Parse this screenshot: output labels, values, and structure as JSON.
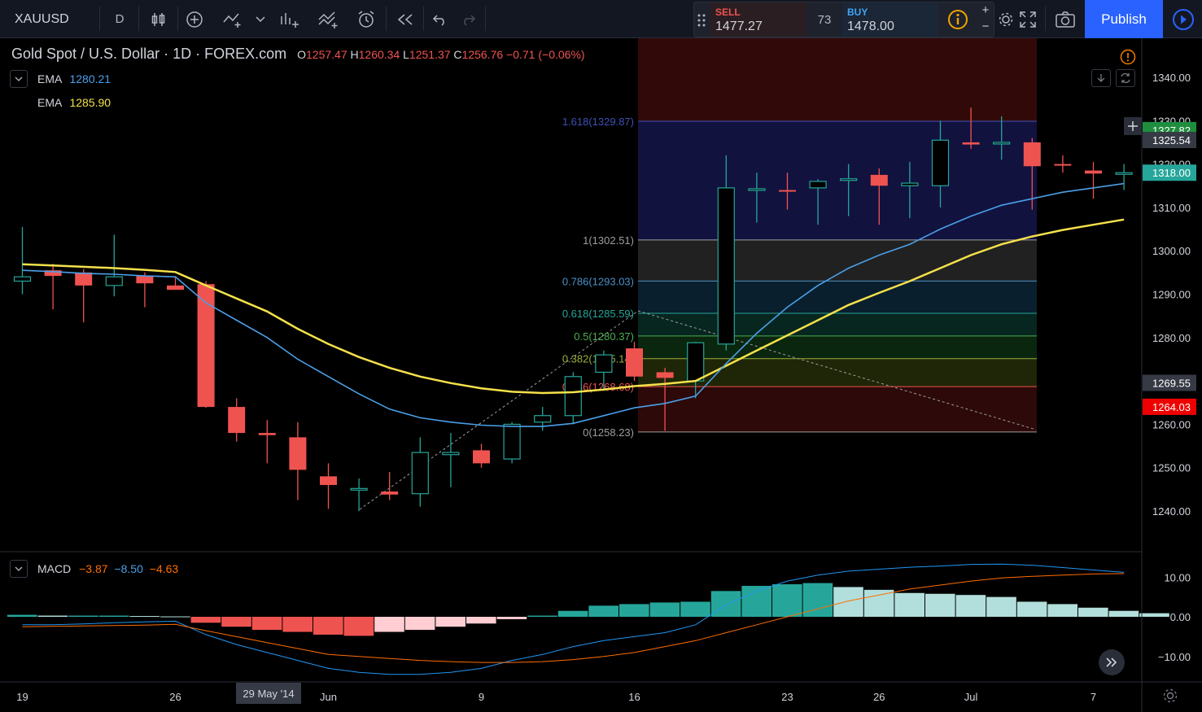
{
  "toolbar": {
    "symbol": "XAUUSD",
    "interval": "D",
    "sell_label": "SELL",
    "sell_price": "1477.27",
    "spread": "73",
    "buy_label": "BUY",
    "buy_price": "1478.00",
    "publish_label": "Publish",
    "plus": "+",
    "minus": "−"
  },
  "legend": {
    "title": "Gold Spot / U.S. Dollar · 1D · FOREX.com",
    "o_key": "O",
    "o_val": "1257.47",
    "h_key": "H",
    "h_val": "1260.34",
    "l_key": "L",
    "l_val": "1251.37",
    "c_key": "C",
    "c_val": "1256.76",
    "change": "−0.71 (−0.06%)"
  },
  "indicators": {
    "ema1_label": "EMA",
    "ema1_value": "1280.21",
    "ema2_label": "EMA",
    "ema2_value": "1285.90",
    "macd_label": "MACD",
    "macd_v1": "−3.87",
    "macd_v2": "−8.50",
    "macd_v3": "−4.63"
  },
  "date_badge": "29 May '14",
  "colors": {
    "up": "#26a69a",
    "down": "#ef5350",
    "ema_fast": "#4a9fe8",
    "ema_slow": "#f5e14b",
    "macd_line": "#2196f3",
    "signal_line": "#ff6d00",
    "accent": "#2962ff"
  },
  "chart_data": {
    "type": "candlestick",
    "ylim": [
      1231,
      1349
    ],
    "y_ticks": [
      1240,
      1250,
      1260,
      1270,
      1280,
      1290,
      1300,
      1310,
      1320,
      1330,
      1340
    ],
    "x_tick_labels": [
      "19",
      "26",
      "Jun",
      "9",
      "16",
      "23",
      "26",
      "Jul",
      "7"
    ],
    "x_tick_index": [
      0,
      5,
      10,
      15,
      20,
      25,
      28,
      31,
      35
    ],
    "candles": [
      {
        "o": 1293.0,
        "h": 1305.5,
        "l": 1290.0,
        "c": 1294.0
      },
      {
        "o": 1295.5,
        "h": 1297.0,
        "l": 1286.5,
        "c": 1294.2
      },
      {
        "o": 1295.0,
        "h": 1295.8,
        "l": 1283.5,
        "c": 1292.0
      },
      {
        "o": 1292.0,
        "h": 1303.7,
        "l": 1289.5,
        "c": 1294.0
      },
      {
        "o": 1294.3,
        "h": 1295.0,
        "l": 1287.0,
        "c": 1292.5
      },
      {
        "o": 1292.0,
        "h": 1294.0,
        "l": 1291.0,
        "c": 1291.0
      },
      {
        "o": 1292.3,
        "h": 1293.0,
        "l": 1263.8,
        "c": 1264.0
      },
      {
        "o": 1264.0,
        "h": 1266.0,
        "l": 1256.0,
        "c": 1258.0
      },
      {
        "o": 1258.0,
        "h": 1261.0,
        "l": 1251.0,
        "c": 1257.5
      },
      {
        "o": 1257.0,
        "h": 1260.5,
        "l": 1242.5,
        "c": 1249.5
      },
      {
        "o": 1248.0,
        "h": 1251.0,
        "l": 1240.5,
        "c": 1246.0
      },
      {
        "o": 1245.0,
        "h": 1247.5,
        "l": 1240.0,
        "c": 1245.2
      },
      {
        "o": 1244.5,
        "h": 1249.0,
        "l": 1242.5,
        "c": 1243.8
      },
      {
        "o": 1244.0,
        "h": 1257.0,
        "l": 1241.0,
        "c": 1253.5
      },
      {
        "o": 1253.0,
        "h": 1258.0,
        "l": 1245.5,
        "c": 1253.5
      },
      {
        "o": 1254.0,
        "h": 1255.5,
        "l": 1250.0,
        "c": 1251.0
      },
      {
        "o": 1252.0,
        "h": 1260.5,
        "l": 1251.0,
        "c": 1260.0
      },
      {
        "o": 1260.5,
        "h": 1264.0,
        "l": 1258.5,
        "c": 1262.0
      },
      {
        "o": 1262.0,
        "h": 1272.0,
        "l": 1260.0,
        "c": 1271.0
      },
      {
        "o": 1272.0,
        "h": 1277.0,
        "l": 1268.0,
        "c": 1276.0
      },
      {
        "o": 1277.5,
        "h": 1279.0,
        "l": 1270.0,
        "c": 1271.0
      },
      {
        "o": 1272.0,
        "h": 1273.0,
        "l": 1258.5,
        "c": 1270.7
      },
      {
        "o": 1270.0,
        "h": 1279.0,
        "l": 1266.0,
        "c": 1278.8
      },
      {
        "o": 1278.5,
        "h": 1322.0,
        "l": 1277.0,
        "c": 1314.5
      },
      {
        "o": 1314.0,
        "h": 1318.0,
        "l": 1306.5,
        "c": 1314.3
      },
      {
        "o": 1314.0,
        "h": 1318.0,
        "l": 1309.5,
        "c": 1313.8
      },
      {
        "o": 1314.5,
        "h": 1316.5,
        "l": 1306.0,
        "c": 1316.0
      },
      {
        "o": 1316.3,
        "h": 1320.0,
        "l": 1308.0,
        "c": 1316.6
      },
      {
        "o": 1317.5,
        "h": 1319.0,
        "l": 1306.0,
        "c": 1315.0
      },
      {
        "o": 1315.0,
        "h": 1320.5,
        "l": 1307.5,
        "c": 1315.6
      },
      {
        "o": 1315.0,
        "h": 1330.0,
        "l": 1310.0,
        "c": 1325.5
      },
      {
        "o": 1325.0,
        "h": 1333.0,
        "l": 1323.5,
        "c": 1324.5
      },
      {
        "o": 1325.0,
        "h": 1331.0,
        "l": 1321.0,
        "c": 1325.0
      },
      {
        "o": 1325.0,
        "h": 1326.0,
        "l": 1309.5,
        "c": 1319.5
      },
      {
        "o": 1320.0,
        "h": 1322.0,
        "l": 1318.0,
        "c": 1319.8
      },
      {
        "o": 1318.5,
        "h": 1320.5,
        "l": 1312.0,
        "c": 1317.8
      },
      {
        "o": 1318.0,
        "h": 1320.0,
        "l": 1314.0,
        "c": 1318.0
      }
    ],
    "ema_fast": [
      1295.5,
      1295.2,
      1294.8,
      1294.6,
      1294.2,
      1294.0,
      1288.0,
      1284.0,
      1280.0,
      1275.0,
      1271.0,
      1267.0,
      1263.5,
      1261.5,
      1260.5,
      1259.8,
      1259.5,
      1259.5,
      1260.2,
      1262.0,
      1263.8,
      1264.8,
      1266.5,
      1274.0,
      1281.0,
      1287.0,
      1292.0,
      1296.0,
      1299.0,
      1301.5,
      1305.0,
      1308.0,
      1310.5,
      1312.0,
      1313.5,
      1314.5,
      1315.5
    ],
    "ema_slow": [
      1296.9,
      1296.6,
      1296.3,
      1296.0,
      1295.6,
      1295.1,
      1292.0,
      1289.0,
      1286.0,
      1282.0,
      1278.5,
      1275.5,
      1273.0,
      1271.0,
      1269.5,
      1268.3,
      1267.5,
      1267.2,
      1267.4,
      1268.0,
      1268.8,
      1269.3,
      1270.0,
      1273.5,
      1277.0,
      1280.5,
      1284.0,
      1287.5,
      1290.3,
      1293.0,
      1296.0,
      1299.0,
      1301.5,
      1303.3,
      1304.8,
      1306.0,
      1307.2
    ],
    "macd_ylim": [
      -16,
      16
    ],
    "macd_ticks": [
      10.0,
      0.0,
      -10.0
    ],
    "histogram": [
      0.5,
      0.3,
      0.3,
      0.3,
      0.2,
      0.1,
      -1.5,
      -2.5,
      -3.3,
      -3.8,
      -4.5,
      -4.8,
      -3.8,
      -3.3,
      -2.5,
      -1.7,
      -0.6,
      0.3,
      1.5,
      2.8,
      3.2,
      3.6,
      3.8,
      6.5,
      7.8,
      8.2,
      8.5,
      7.5,
      6.8,
      6.0,
      5.8,
      5.5,
      5.0,
      3.8,
      3.2,
      2.3,
      1.5,
      0.9
    ],
    "macd_line": [
      -2.0,
      -2.0,
      -1.8,
      -1.5,
      -1.3,
      -1.1,
      -4.5,
      -7.0,
      -9.0,
      -11.0,
      -13.0,
      -14.0,
      -14.5,
      -14.5,
      -14.0,
      -13.0,
      -11.0,
      -9.5,
      -7.5,
      -6.0,
      -5.0,
      -4.0,
      -2.0,
      3.0,
      6.5,
      9.0,
      10.5,
      11.5,
      12.0,
      12.5,
      12.8,
      13.2,
      13.3,
      13.0,
      12.4,
      11.8,
      11.2
    ],
    "signal_line": [
      -2.5,
      -2.4,
      -2.3,
      -2.2,
      -2.1,
      -1.9,
      -3.5,
      -5.0,
      -6.5,
      -8.0,
      -9.5,
      -10.0,
      -10.5,
      -11.0,
      -11.3,
      -11.5,
      -11.5,
      -11.3,
      -10.8,
      -10.0,
      -9.0,
      -7.5,
      -6.0,
      -4.0,
      -2.0,
      0.0,
      2.0,
      4.0,
      5.5,
      7.0,
      8.0,
      9.0,
      9.8,
      10.2,
      10.5,
      10.8,
      10.9
    ],
    "fib_levels": [
      {
        "label": "1.618(1329.87)",
        "value": 1329.87,
        "color": "#3f51b5",
        "fill": "rgba(40,40,140,0.45)"
      },
      {
        "label": "1(1302.51)",
        "value": 1302.51,
        "color": "#9e9e9e",
        "fill": "rgba(120,120,120,0.28)"
      },
      {
        "label": "0.786(1293.03)",
        "value": 1293.03,
        "color": "#4a90c8",
        "fill": "rgba(30,90,130,0.35)"
      },
      {
        "label": "0.618(1285.59)",
        "value": 1285.59,
        "color": "#26a69a",
        "fill": "rgba(20,110,90,0.35)"
      },
      {
        "label": "0.5(1280.37)",
        "value": 1280.37,
        "color": "#4caf50",
        "fill": "rgba(30,110,40,0.35)"
      },
      {
        "label": "0.382(1275.14)",
        "value": 1275.14,
        "color": "#9caf3c",
        "fill": "rgba(90,110,20,0.35)"
      },
      {
        "label": "0.236(1268.68)",
        "value": 1268.68,
        "color": "#ef5350",
        "fill": "rgba(130,25,25,0.35)"
      },
      {
        "label": "0(1258.23)",
        "value": 1258.23,
        "color": "#9e9e9e",
        "fill": "rgba(110,20,20,0.4)"
      }
    ],
    "price_labels": [
      {
        "text": "1327.82",
        "value": 1327.82,
        "bg": "#1e8e3e",
        "color": "#ffffff"
      },
      {
        "text": "1325.54",
        "value": 1325.54,
        "bg": "#363a45",
        "color": "#ffffff"
      },
      {
        "text": "1318.00",
        "value": 1318.0,
        "bg": "#26a69a",
        "color": "#ffffff"
      },
      {
        "text": "1269.55",
        "value": 1269.55,
        "bg": "#363a45",
        "color": "#ffffff"
      },
      {
        "text": "1264.03",
        "value": 1264.03,
        "bg": "#ef0000",
        "color": "#ffffff"
      }
    ]
  }
}
